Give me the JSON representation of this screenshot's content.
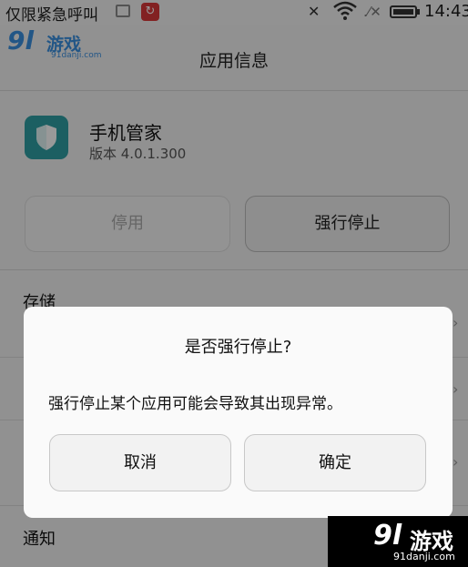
{
  "status_bar": {
    "carrier": "仅限紧急呼叫",
    "time": "14:43",
    "icons": [
      "image-icon",
      "sync-icon",
      "mute-icon",
      "wifi-icon",
      "signal-icon",
      "battery-icon"
    ]
  },
  "watermark": {
    "logo": "9l",
    "name": "游戏",
    "url_top": "91danji.com",
    "url_bottom": "91danji.com"
  },
  "header": {
    "title": "应用信息"
  },
  "app": {
    "name": "手机管家",
    "version": "版本 4.0.1.300",
    "icon": "shield-icon",
    "icon_color": "#2f9fa3"
  },
  "actions": {
    "disable_label": "停用",
    "force_stop_label": "强行停止"
  },
  "list": {
    "storage_label": "存储",
    "notify_label": "通知"
  },
  "dialog": {
    "title": "是否强行停止?",
    "message": "强行停止某个应用可能会导致其出现异常。",
    "cancel_label": "取消",
    "confirm_label": "确定"
  }
}
